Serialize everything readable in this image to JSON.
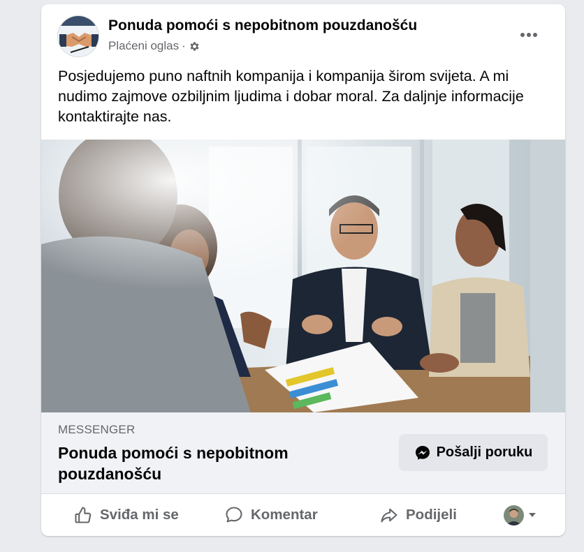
{
  "post": {
    "page_name": "Ponuda pomoći s nepobitnom pouzdanošću",
    "sponsored_label": "Plaćeni oglas",
    "separator": "·",
    "body_text": "Posjedujemo puno naftnih kompanija i kompanija širom svijeta. A mi nudimo zajmove ozbiljnim ljudima i dobar moral. Za daljnje informacije kontaktirajte nas.",
    "more_icon": "more-horizontal-icon",
    "audience_icon": "gear-icon"
  },
  "link_preview": {
    "domain": "MESSENGER",
    "title": "Ponuda pomoći s nepobitnom pouzdanošću",
    "cta_label": "Pošalji poruku",
    "cta_icon": "messenger-icon"
  },
  "actions": {
    "like_label": "Sviđa mi se",
    "comment_label": "Komentar",
    "share_label": "Podijeli"
  },
  "colors": {
    "background": "#e9ebee",
    "card": "#ffffff",
    "secondary_text": "#65676b",
    "button_bg": "#e4e6eb"
  }
}
